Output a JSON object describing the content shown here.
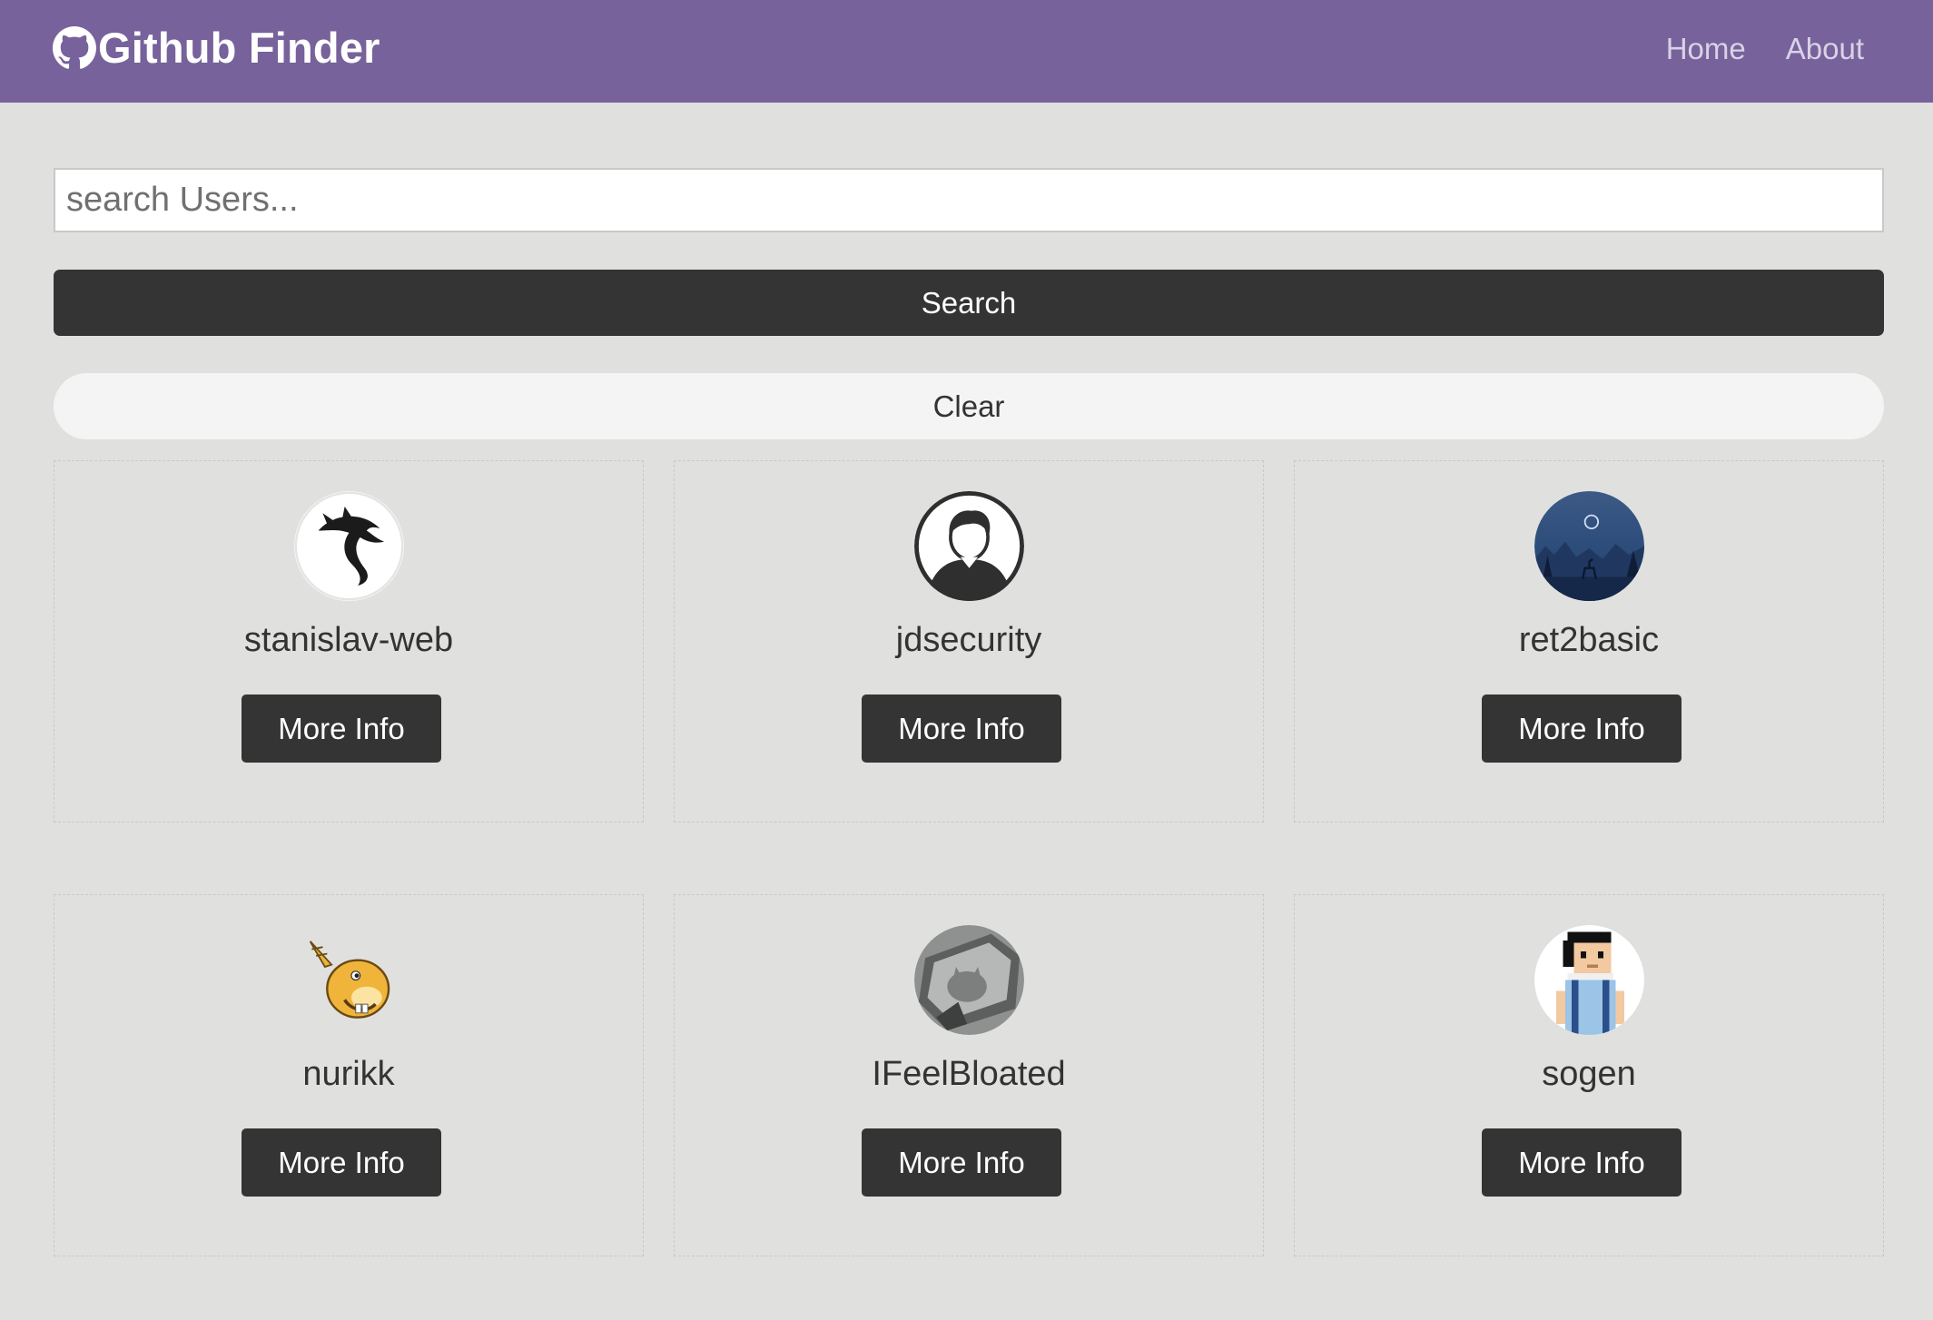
{
  "navbar": {
    "brand_icon": "github-icon",
    "title": "Github Finder",
    "links": [
      {
        "label": "Home"
      },
      {
        "label": "About"
      }
    ],
    "background_color": "#77629b"
  },
  "search": {
    "placeholder": "search Users...",
    "value": "",
    "search_label": "Search",
    "clear_label": "Clear"
  },
  "users": [
    {
      "login": "stanislav-web",
      "avatar_icon": "kali-dragon-avatar",
      "button_label": "More Info"
    },
    {
      "login": "jdsecurity",
      "avatar_icon": "default-person-avatar",
      "button_label": "More Info"
    },
    {
      "login": "ret2basic",
      "avatar_icon": "night-deer-avatar",
      "button_label": "More Info"
    },
    {
      "login": "nurikk",
      "avatar_icon": "beaver-cartoon-avatar",
      "button_label": "More Info"
    },
    {
      "login": "IFeelBloated",
      "avatar_icon": "cat-photo-avatar",
      "button_label": "More Info"
    },
    {
      "login": "sogen",
      "avatar_icon": "pixel-man-avatar",
      "button_label": "More Info"
    }
  ],
  "colors": {
    "accent": "#77629b",
    "page_background": "#e0e1df",
    "dark_button": "#343434",
    "light_button": "#f4f4f4"
  }
}
